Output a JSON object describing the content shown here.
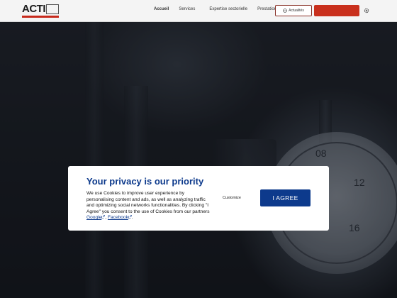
{
  "header": {
    "logo_text": "ACTI",
    "nav": [
      {
        "label": "Accueil"
      },
      {
        "label": "Services"
      },
      {
        "label": "Expertise sectorielle"
      },
      {
        "label": "Prestations qualité"
      }
    ],
    "outline_button_label": "Actualités"
  },
  "hero": {
    "gauge_labels": [
      "08",
      "12",
      "16"
    ]
  },
  "cookie_banner": {
    "title": "Your privacy is our priority",
    "body_text": "We use Cookies to improve user experience by personalising content and ads, as well as analyzing traffic and optimizing social networks functionalities. By clicking \"I Agree\" you consent to the use of Cookies from our partners",
    "link_google": "Google",
    "link_separator": ", ",
    "link_facebook": "Facebook",
    "link_end": ".",
    "customize_label": "Customize",
    "agree_label": "I AGREE",
    "accent_color": "#0d3a8c"
  }
}
